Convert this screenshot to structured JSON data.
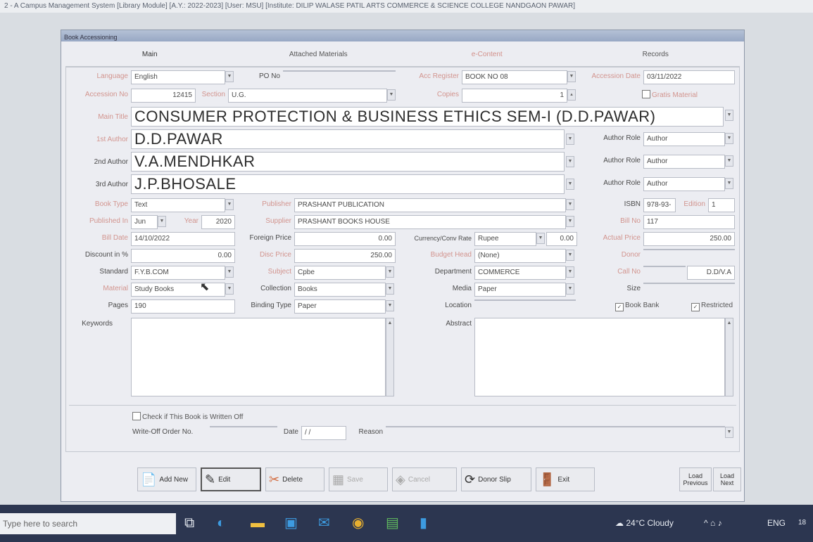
{
  "window_title": "2 - A Campus Management System [Library Module] [A.Y.: 2022-2023] [User: MSU] [Institute: DILIP WALASE PATIL ARTS COMMERCE & SCIENCE COLLEGE NANDGAON PAWAR]",
  "dialog_caption": "Book Accessioning",
  "tabs": [
    "Main",
    "Attached Materials",
    "e-Content",
    "Records"
  ],
  "labels": {
    "language": "Language",
    "po_no": "PO No",
    "acc_register": "Acc Register",
    "accession_date": "Accession Date",
    "accession_no": "Accession No",
    "section": "Section",
    "copies": "Copies",
    "gratis": "Gratis Material",
    "main_title": "Main Title",
    "first_author": "1st Author",
    "second_author": "2nd Author",
    "third_author": "3rd Author",
    "author_role": "Author Role",
    "book_type": "Book Type",
    "publisher": "Publisher",
    "isbn": "ISBN",
    "edition": "Edition",
    "published_in": "Published In",
    "year": "Year",
    "supplier": "Supplier",
    "bill_no": "Bill No",
    "bill_date": "Bill Date",
    "foreign_price": "Foreign Price",
    "currency": "Currency/Conv Rate",
    "actual_price": "Actual Price",
    "discount": "Discount in %",
    "disc_price": "Disc Price",
    "budget_head": "Budget Head",
    "donor": "Donor",
    "standard": "Standard",
    "subject": "Subject",
    "department": "Department",
    "call_no": "Call No",
    "material": "Material",
    "collection": "Collection",
    "media": "Media",
    "size": "Size",
    "pages": "Pages",
    "binding_type": "Binding Type",
    "location": "Location",
    "book_bank": "Book Bank",
    "restricted": "Restricted",
    "keywords": "Keywords",
    "abstract": "Abstract",
    "write_off_check": "Check if This Book is Written Off",
    "write_off_order": "Write-Off Order No.",
    "date": "Date",
    "reason": "Reason"
  },
  "values": {
    "language": "English",
    "acc_register": "BOOK NO 08",
    "accession_date": "03/11/2022",
    "accession_no": "12415",
    "section": "U.G.",
    "copies": "1",
    "main_title": "CONSUMER PROTECTION & BUSINESS ETHICS SEM-I (D.D.PAWAR)",
    "first_author": "D.D.PAWAR",
    "second_author": "V.A.MENDHKAR",
    "third_author": "J.P.BHOSALE",
    "author_role_1": "Author",
    "author_role_2": "Author",
    "author_role_3": "Author",
    "book_type": "Text",
    "publisher": "PRASHANT PUBLICATION",
    "isbn": "978-93-",
    "edition": "1",
    "published_month": "Jun",
    "year": "2020",
    "supplier": "PRASHANT BOOKS HOUSE",
    "bill_no": "117",
    "bill_date": "14/10/2022",
    "foreign_price": "0.00",
    "currency": "Rupee",
    "conv_rate": "0.00",
    "actual_price": "250.00",
    "discount": "0.00",
    "disc_price": "250.00",
    "budget_head": "(None)",
    "standard": "F.Y.B.COM",
    "subject": "Cpbe",
    "department": "COMMERCE",
    "call_no": "D.D/V.A",
    "material": "Study Books",
    "collection": "Books",
    "media": "Paper",
    "pages": "190",
    "binding_type": "Paper",
    "write_off_date": "/ /"
  },
  "buttons": {
    "add_new": "Add New",
    "edit": "Edit",
    "delete": "Delete",
    "save": "Save",
    "cancel": "Cancel",
    "donor_slip": "Donor Slip",
    "exit": "Exit",
    "load_previous": "Load Previous",
    "load_next": "Load Next"
  },
  "taskbar": {
    "search_placeholder": "Type here to search",
    "weather": "24°C Cloudy",
    "language": "ENG",
    "time": "18"
  },
  "colors": {
    "accent_label": "#d2948e",
    "taskbar": "#2c3650"
  }
}
